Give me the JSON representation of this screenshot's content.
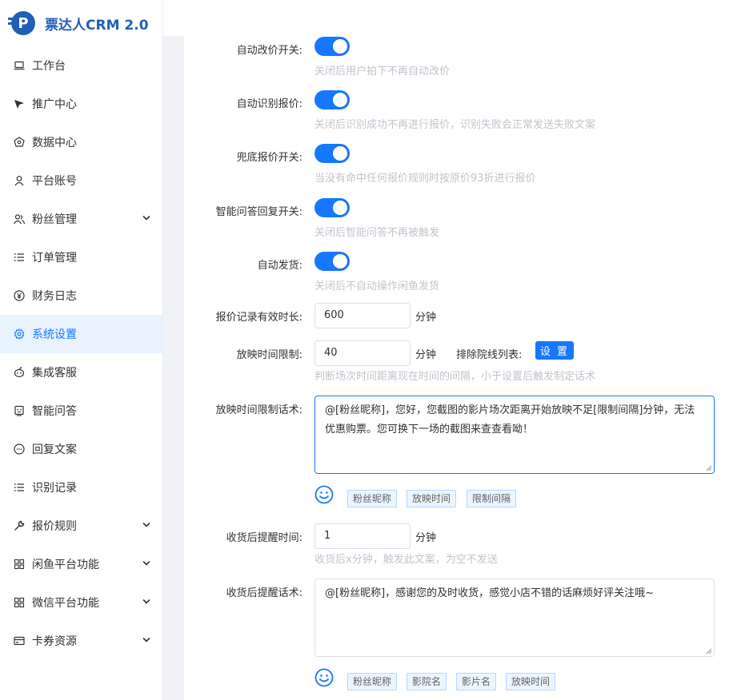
{
  "app": {
    "title": "票达人CRM 2.0",
    "brand_color": "#1677ff"
  },
  "sidebar": {
    "items": [
      {
        "label": "工作台",
        "icon": "laptop-icon",
        "expandable": false
      },
      {
        "label": "推广中心",
        "icon": "send-icon",
        "expandable": false
      },
      {
        "label": "数据中心",
        "icon": "gem-icon",
        "expandable": false
      },
      {
        "label": "平台账号",
        "icon": "user-icon",
        "expandable": false
      },
      {
        "label": "粉丝管理",
        "icon": "users-icon",
        "expandable": true
      },
      {
        "label": "订单管理",
        "icon": "list-icon",
        "expandable": false
      },
      {
        "label": "财务日志",
        "icon": "yen-icon",
        "expandable": false
      },
      {
        "label": "系统设置",
        "icon": "gear-icon",
        "expandable": false,
        "active": true
      },
      {
        "label": "集成客服",
        "icon": "bot-icon",
        "expandable": false
      },
      {
        "label": "智能问答",
        "icon": "robot-face-icon",
        "expandable": false
      },
      {
        "label": "回复文案",
        "icon": "chat-icon",
        "expandable": false
      },
      {
        "label": "识别记录",
        "icon": "list-icon",
        "expandable": false
      },
      {
        "label": "报价规则",
        "icon": "wrench-icon",
        "expandable": true
      },
      {
        "label": "闲鱼平台功能",
        "icon": "grid-icon",
        "expandable": true
      },
      {
        "label": "微信平台功能",
        "icon": "grid-icon",
        "expandable": true
      },
      {
        "label": "卡券资源",
        "icon": "card-icon",
        "expandable": true
      }
    ]
  },
  "form": {
    "auto_price_change": {
      "label": "自动改价开关:",
      "on": true,
      "hint": "关闭后用户拍下不再自动改价"
    },
    "auto_recognize_quote": {
      "label": "自动识别报价:",
      "on": true,
      "hint": "关闭后识别成功不再进行报价，识别失败会正常发送失败文案"
    },
    "fallback_quote": {
      "label": "兜底报价开关:",
      "on": true,
      "hint": "当没有命中任何报价规则时按原价93折进行报价"
    },
    "smart_qa_reply": {
      "label": "智能问答回复开关:",
      "on": true,
      "hint": "关闭后智能问答不再被触发"
    },
    "auto_ship": {
      "label": "自动发货:",
      "on": true,
      "hint": "关闭后不自动操作闲鱼发货"
    },
    "quote_valid_duration": {
      "label": "报价记录有效时长:",
      "value": "600",
      "unit": "分钟"
    },
    "show_time_limit": {
      "label": "放映时间限制:",
      "value": "40",
      "unit": "分钟",
      "exclude_label": "排除院线列表:",
      "set_button": "设 置",
      "hint": "判断场次时间距离现在时间的间隔，小于设置后触发制定话术"
    },
    "show_time_limit_script": {
      "label": "放映时间限制话术:",
      "text": "@[粉丝昵称]，您好，您截图的影片场次距离开始放映不足[限制间隔]分钟，无法优惠购票。您可换下一场的截图来查查看呦！",
      "tags": [
        "粉丝昵称",
        "放映时间",
        "限制间隔"
      ]
    },
    "post_receipt_reminder_time": {
      "label": "收货后提醒时间:",
      "value": "1",
      "unit": "分钟",
      "hint": "收货后x分钟，触发此文案，为空不发送"
    },
    "post_receipt_reminder_script": {
      "label": "收货后提醒话术:",
      "text": "@[粉丝昵称]，感谢您的及时收货，感觉小店不错的话麻烦好评关注哦~",
      "tags": [
        "粉丝昵称",
        "影院名",
        "影片名",
        "放映时间"
      ]
    }
  }
}
